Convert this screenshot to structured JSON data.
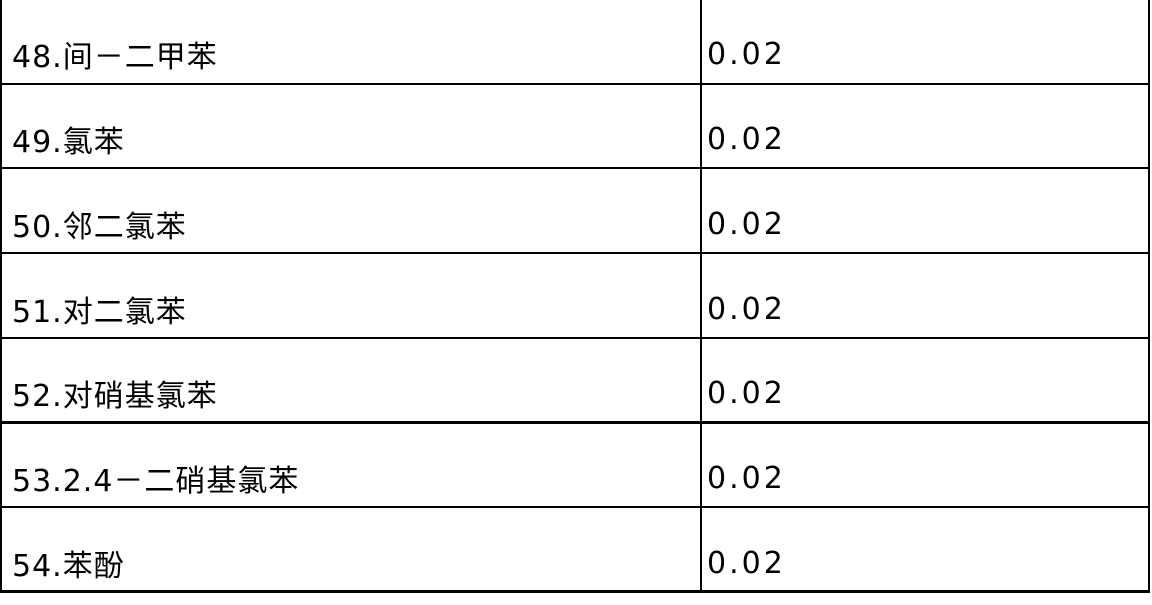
{
  "table": {
    "rows": [
      {
        "name": "48.间－二甲苯",
        "value": "0.02"
      },
      {
        "name": "49.氯苯",
        "value": "0.02"
      },
      {
        "name": "50.邻二氯苯",
        "value": "0.02"
      },
      {
        "name": "51.对二氯苯",
        "value": "0.02"
      },
      {
        "name": "52.对硝基氯苯",
        "value": "0.02"
      },
      {
        "name": "53.2.4－二硝基氯苯",
        "value": "0.02"
      },
      {
        "name": "54.苯酚",
        "value": "0.02"
      }
    ]
  }
}
